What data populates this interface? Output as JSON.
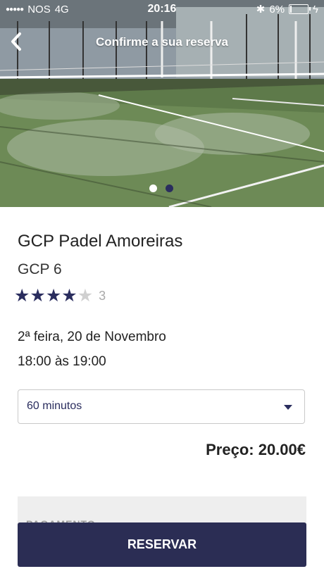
{
  "status_bar": {
    "carrier": "NOS",
    "network": "4G",
    "time": "20:16",
    "battery": "6%",
    "battery_level": 0.06
  },
  "nav": {
    "title": "Confirme a sua reserva",
    "back_icon": "chevron-left-icon"
  },
  "gallery": {
    "image_count": 2,
    "active_index": 0
  },
  "booking": {
    "venue": "GCP Padel Amoreiras",
    "court": "GCP 6",
    "rating": 4,
    "rating_max": 5,
    "rating_count": "3",
    "date": "2ª feira, 20 de Novembro",
    "time_range": "18:00 às 19:00"
  },
  "duration": {
    "selected": "60 minutos"
  },
  "price_label": "Preço: 20.00€",
  "payment_heading": "PAGAMENTO",
  "reserve_button": "RESERVAR",
  "colors": {
    "accent": "#2b2d54",
    "star_on": "#2a2d5e",
    "star_off": "#d0d0d0"
  }
}
